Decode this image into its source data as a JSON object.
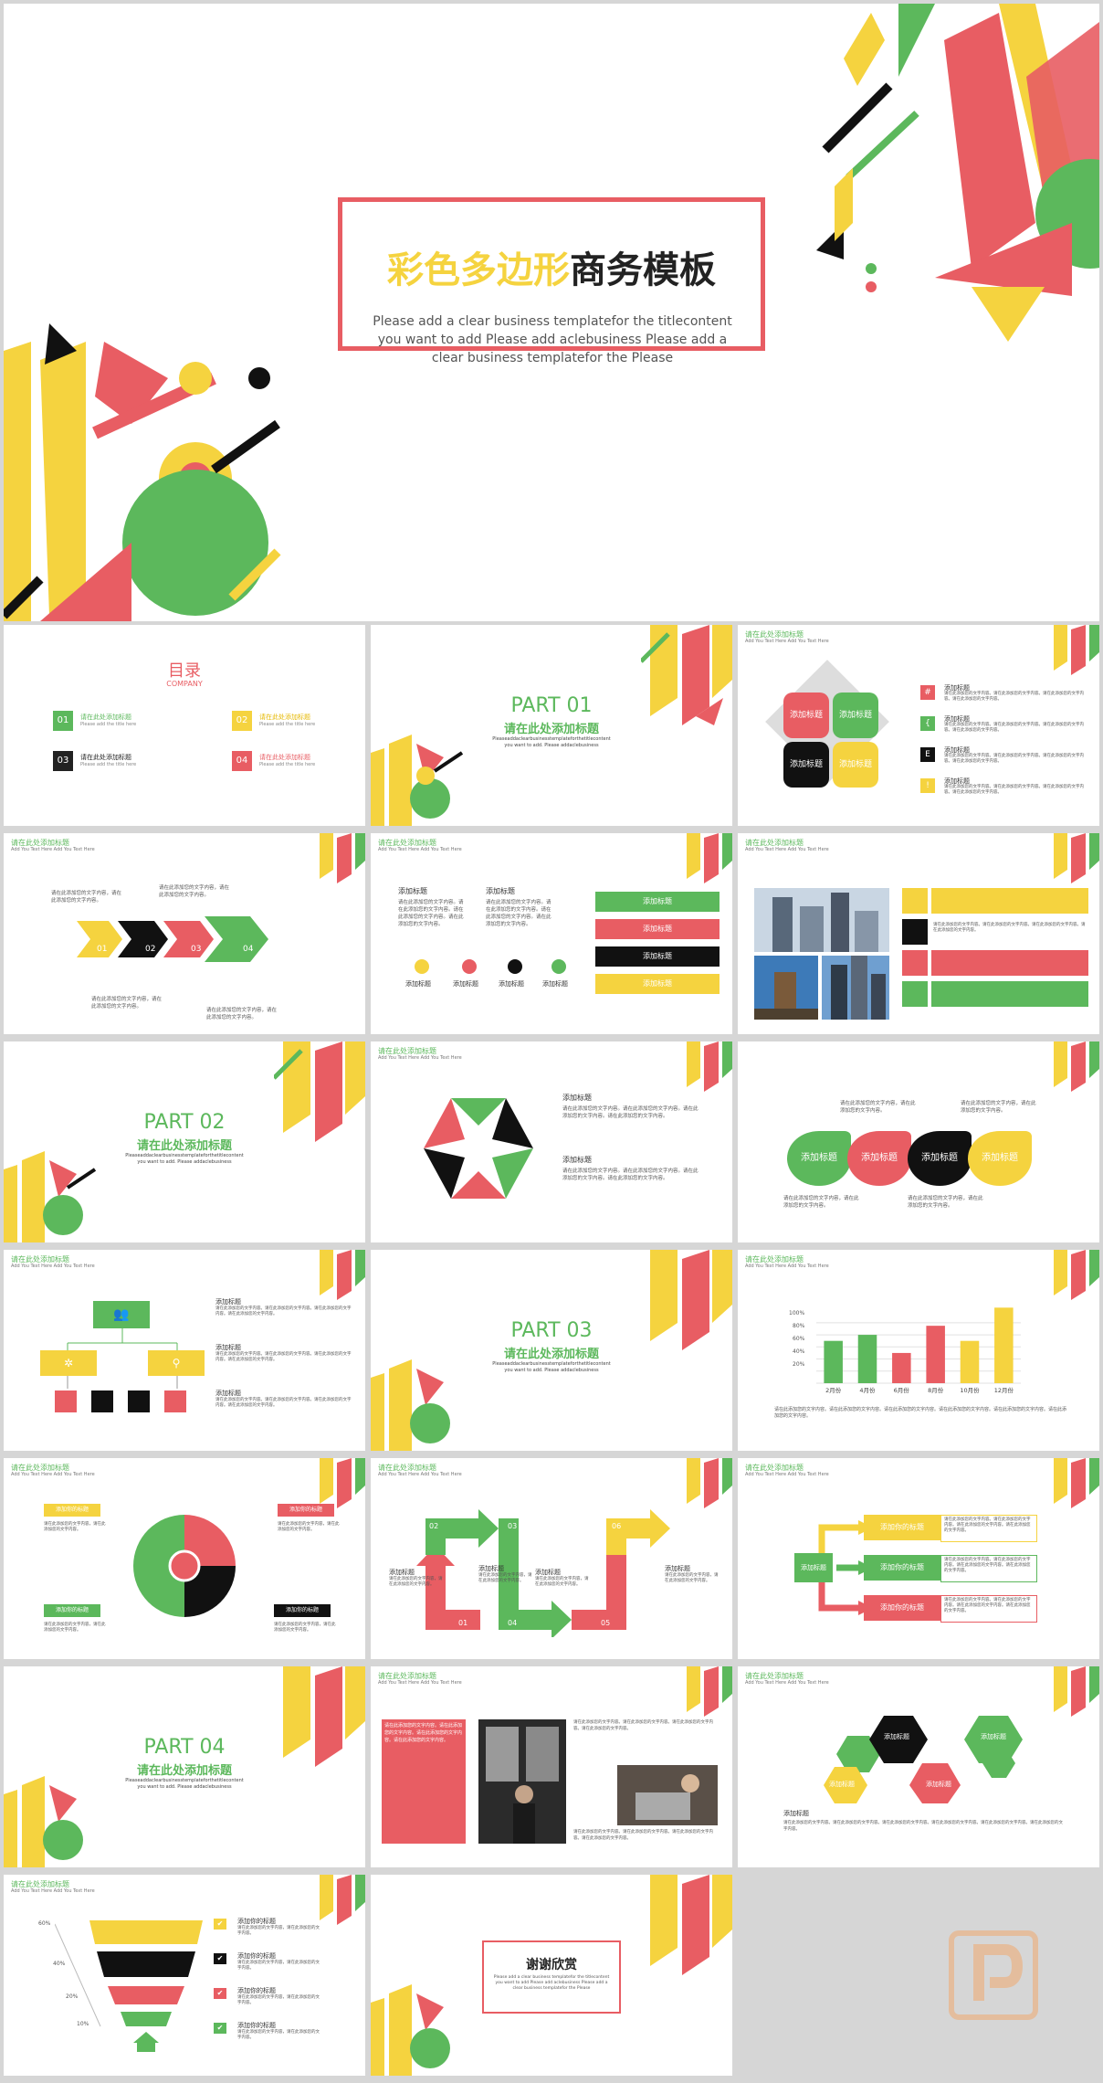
{
  "cover": {
    "title_colored": "彩色多边形",
    "title_rest": "商务模板",
    "subtitle": "Please add a clear business templatefor the titlecontent you want to add Please add aclebusiness Please add a clear business templatefor the Please"
  },
  "common": {
    "header_title": "请在此处添加标题",
    "header_sub": "Add You Text Here Add You Text Here",
    "add_title": "添加标题",
    "add_your_title": "添加你的标题",
    "body_text": "请在此添加您的文字内容，请在此添加您的文字内容。",
    "body_text_long": "请在此添加您的文字内容。请在此添加您的文字内容。请在此添加您的文字内容。请在此添加您的文字内容。",
    "section_subtitle": "请在此处添加标题",
    "section_desc": "Pleaseaddaclearbusinesstemplateforthetitlecontent you want to add. Please addaclebusiness"
  },
  "toc": {
    "title": "目录",
    "subtitle": "COMPANY",
    "items": [
      {
        "num": "01",
        "title": "请在此处添加标题",
        "sub": "Please add the title here",
        "color": "#5cb85c"
      },
      {
        "num": "02",
        "title": "请在此处添加标题",
        "sub": "Please add the title here",
        "color": "#f5d33f"
      },
      {
        "num": "03",
        "title": "请在此处添加标题",
        "sub": "Please add the title here",
        "color": "#222222"
      },
      {
        "num": "04",
        "title": "请在此处添加标题",
        "sub": "Please add the title here",
        "color": "#e85d63"
      }
    ]
  },
  "parts": {
    "p1": "PART 01",
    "p2": "PART 02",
    "p3": "PART 03",
    "p4": "PART 04"
  },
  "arrows": {
    "n1": "01",
    "n2": "02",
    "n3": "03",
    "n4": "04"
  },
  "flow_steps": {
    "s1": "01",
    "s2": "02",
    "s3": "03",
    "s4": "04",
    "s5": "05",
    "s6": "06"
  },
  "bar_chart": {
    "y_ticks": [
      "100%",
      "80%",
      "60%",
      "40%",
      "20%"
    ],
    "footer": "请在此添加您的文字内容。请在此添加您的文字内容。请在此添加您的文字内容。请在此添加您的文字内容。请在此添加您的文字内容。请在此添加您的文字内容。"
  },
  "chart_data": {
    "type": "bar",
    "categories": [
      "2月份",
      "4月份",
      "6月份",
      "8月份",
      "10月份",
      "12月份"
    ],
    "values": [
      70,
      80,
      50,
      95,
      70,
      125
    ],
    "ylim": [
      0,
      130
    ],
    "colors": [
      "#5cb85c",
      "#5cb85c",
      "#e85d63",
      "#e85d63",
      "#f5d33f",
      "#f5d33f"
    ]
  },
  "funnel": {
    "ticks": [
      "60%",
      "40%",
      "20%",
      "10%"
    ]
  },
  "thanks": {
    "title": "谢谢欣赏",
    "sub": "Please add a clear business templatefor the titlecontent you want to add Please add aclebusiness Please add a clear business templatefor the Please"
  },
  "colors": {
    "green": "#5cb85c",
    "red": "#e85d63",
    "yellow": "#f5d33f",
    "black": "#1a1a1a"
  }
}
